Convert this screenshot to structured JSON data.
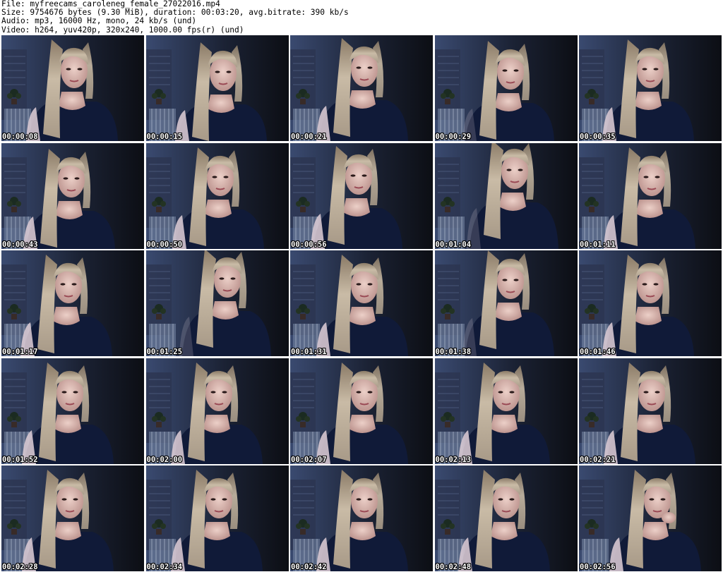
{
  "info": {
    "file": "File: myfreecams_caroleneg_female_27022016.mp4",
    "size": "Size: 9754676 bytes (9.30 MiB), duration: 00:03:20, avg.bitrate: 390 kb/s",
    "audio": "Audio: mp3, 16000 Hz, mono, 24 kb/s (und)",
    "video": "Video: h264, yuv420p, 320x240, 1000.00 fps(r) (und)"
  },
  "timestamps": [
    "00:00:08",
    "00:00:15",
    "00:00:21",
    "00:00:29",
    "00:00:35",
    "00:00:43",
    "00:00:50",
    "00:00:56",
    "00:01:04",
    "00:01:11",
    "00:01:17",
    "00:01:25",
    "00:01:31",
    "00:01:38",
    "00:01:46",
    "00:01:52",
    "00:02:00",
    "00:02:07",
    "00:02:13",
    "00:02:21",
    "00:02:28",
    "00:02:34",
    "00:02:42",
    "00:02:48",
    "00:02:56"
  ],
  "colors": {
    "background": "#ffffff",
    "info_text": "#000000",
    "timestamp_text": "#ffffff",
    "timestamp_outline": "#000000",
    "room_dark": "#0c0e14",
    "wall_blue": "#3a4a70",
    "shirt": "#101a38",
    "skin": "#d8b6b0",
    "hair": "#c9bba6"
  }
}
